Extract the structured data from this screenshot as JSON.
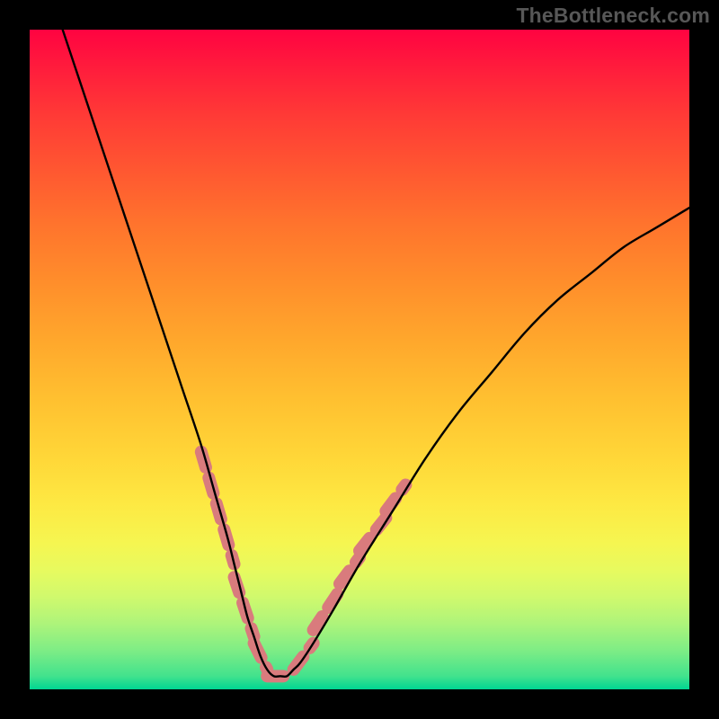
{
  "watermark": "TheBottleneck.com",
  "chart_data": {
    "type": "line",
    "title": "",
    "xlabel": "",
    "ylabel": "",
    "xlim": [
      0,
      100
    ],
    "ylim": [
      0,
      100
    ],
    "grid": false,
    "legend": false,
    "series": [
      {
        "name": "bottleneck-curve",
        "color": "#000000",
        "x": [
          5,
          8,
          11,
          14,
          17,
          20,
          23,
          26,
          28,
          30,
          31,
          32,
          33,
          34,
          35,
          36,
          37,
          38,
          39,
          40,
          41,
          43,
          46,
          50,
          55,
          60,
          65,
          70,
          75,
          80,
          85,
          90,
          95,
          100
        ],
        "y": [
          100,
          91,
          82,
          73,
          64,
          55,
          46,
          37,
          30,
          23,
          19,
          15,
          11,
          8,
          5,
          3,
          2,
          2,
          2,
          3,
          4,
          7,
          12,
          19,
          27,
          35,
          42,
          48,
          54,
          59,
          63,
          67,
          70,
          73
        ]
      },
      {
        "name": "highlight-segments",
        "color": "#d97b7d",
        "style": "thick-dashed",
        "segments": [
          {
            "x": [
              26,
              31
            ],
            "y": [
              36,
              19
            ]
          },
          {
            "x": [
              31,
              34
            ],
            "y": [
              17,
              8
            ]
          },
          {
            "x": [
              34,
              36
            ],
            "y": [
              7,
              3
            ]
          },
          {
            "x": [
              36,
              40
            ],
            "y": [
              2,
              2
            ]
          },
          {
            "x": [
              40,
              43
            ],
            "y": [
              3,
              7
            ]
          },
          {
            "x": [
              43,
              47
            ],
            "y": [
              9,
              15
            ]
          },
          {
            "x": [
              47,
              50
            ],
            "y": [
              16,
              20
            ]
          },
          {
            "x": [
              50,
              54
            ],
            "y": [
              21,
              26
            ]
          },
          {
            "x": [
              54,
              57
            ],
            "y": [
              27,
              31
            ]
          }
        ]
      }
    ],
    "background": {
      "type": "vertical-gradient",
      "stops": [
        {
          "pos": 0.0,
          "color": "#ff0341"
        },
        {
          "pos": 0.5,
          "color": "#ffc030"
        },
        {
          "pos": 0.8,
          "color": "#f5f651"
        },
        {
          "pos": 1.0,
          "color": "#00d692"
        }
      ]
    }
  }
}
